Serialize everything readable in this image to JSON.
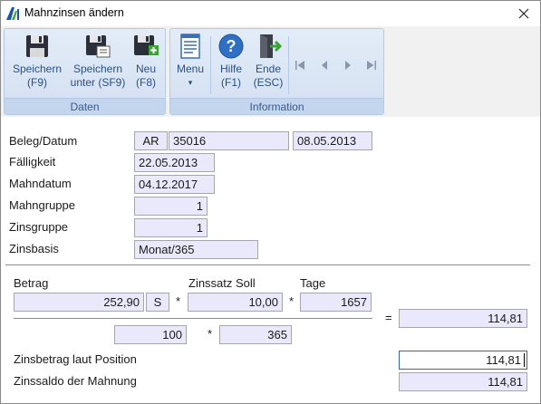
{
  "window": {
    "title": "Mahnzinsen ändern"
  },
  "ribbon": {
    "groups": {
      "daten": "Daten",
      "information": "Information"
    },
    "buttons": {
      "speichern": {
        "line1": "Speichern",
        "line2": "(F9)"
      },
      "speichern_unter": {
        "line1": "Speichern",
        "line2": "unter (SF9)"
      },
      "neu": {
        "line1": "Neu",
        "line2": "(F8)"
      },
      "menu": {
        "line1": "Menu",
        "line2": "▾"
      },
      "hilfe": {
        "line1": "Hilfe",
        "line2": "(F1)"
      },
      "ende": {
        "line1": "Ende",
        "line2": "(ESC)"
      }
    }
  },
  "form": {
    "labels": {
      "beleg_datum": "Beleg/Datum",
      "faelligkeit": "Fälligkeit",
      "mahndatum": "Mahndatum",
      "mahngruppe": "Mahngruppe",
      "zinsgruppe": "Zinsgruppe",
      "zinsbasis": "Zinsbasis",
      "betrag": "Betrag",
      "zinssatz_soll": "Zinssatz Soll",
      "tage": "Tage",
      "zinsbetrag_position": "Zinsbetrag laut Position",
      "zinssaldo_mahnung": "Zinssaldo der Mahnung"
    },
    "values": {
      "beleg_typ": "AR",
      "beleg_nr": "35016",
      "beleg_datum": "08.05.2013",
      "faelligkeit": "22.05.2013",
      "mahndatum": "04.12.2017",
      "mahngruppe": "1",
      "zinsgruppe": "1",
      "zinsbasis": "Monat/365",
      "betrag": "252,90",
      "betrag_flag": "S",
      "zinssatz_soll": "10,00",
      "tage": "1657",
      "ergebnis": "114,81",
      "divisor_prozent": "100",
      "divisor_tage": "365",
      "zinsbetrag_position": "114,81",
      "zinssaldo_mahnung": "114,81"
    },
    "operators": {
      "mal1": "*",
      "mal2": "*",
      "mal3": "*",
      "gleich": "="
    }
  },
  "colors": {
    "field_bg": "#eae8fb",
    "ribbon_blue": "#2a4f86",
    "accent_focus": "#2c64c8"
  }
}
